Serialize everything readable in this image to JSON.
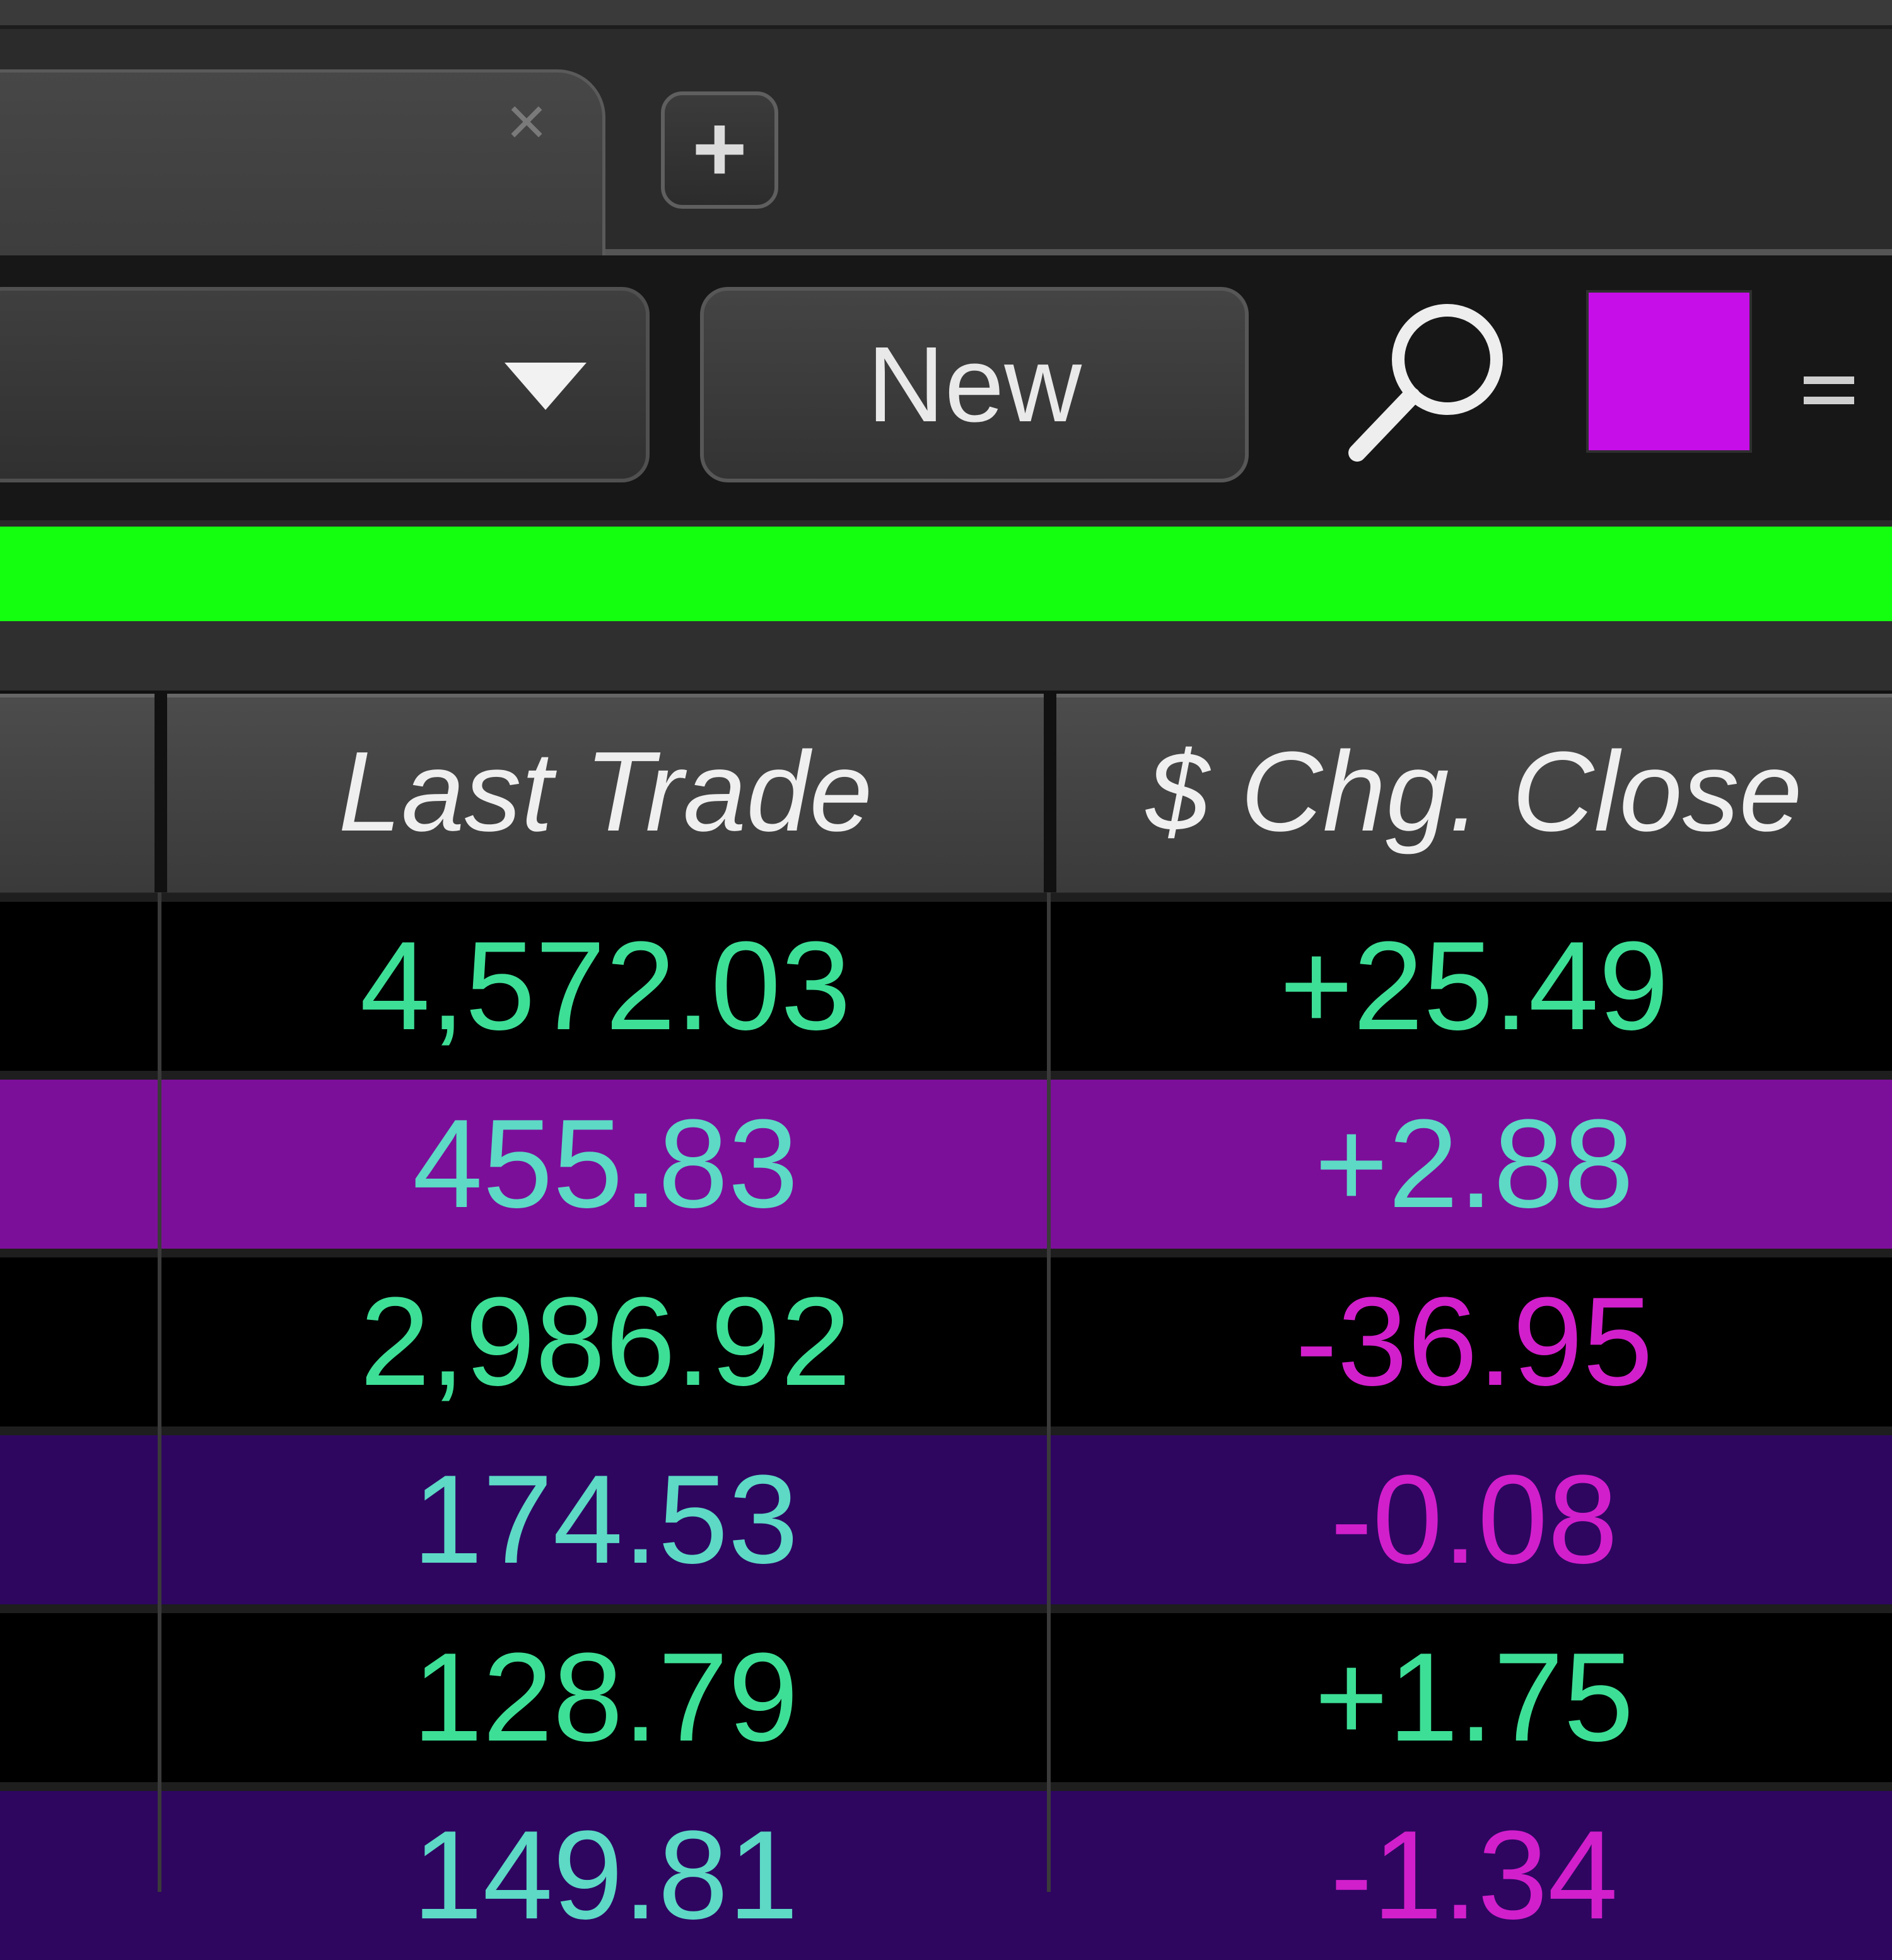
{
  "tabs": {
    "close_glyph": "×",
    "add_glyph": "+"
  },
  "toolbar": {
    "new_label": "New",
    "search_icon": "search-icon",
    "swatch_color": "#c60ee8",
    "menu_icon": "menu-icon"
  },
  "status_strip_color": "#14ff10",
  "table": {
    "columns": [
      "",
      "Last Trade",
      "$ Chg. Close"
    ],
    "rows": [
      {
        "last_trade": "4,572.03",
        "chg_close": "+25.49"
      },
      {
        "last_trade": "455.83",
        "chg_close": "+2.88"
      },
      {
        "last_trade": "2,986.92",
        "chg_close": "-36.95"
      },
      {
        "last_trade": "174.53",
        "chg_close": "-0.08"
      },
      {
        "last_trade": "128.79",
        "chg_close": "+1.75"
      },
      {
        "last_trade": "149.81",
        "chg_close": "-1.34"
      }
    ]
  },
  "colors": {
    "positive": "#3ddf96",
    "negative": "#d21fcc",
    "row_highlight_purple": "#7c0f99",
    "row_highlight_indigo": "#2e0660"
  }
}
